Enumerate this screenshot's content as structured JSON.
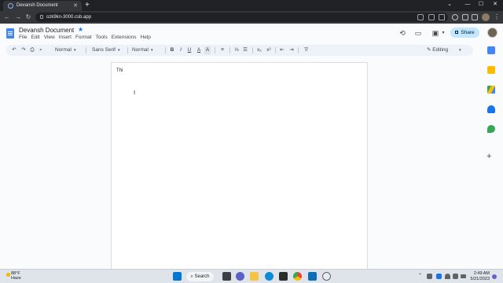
{
  "browser": {
    "tab_title": "Devansh Document",
    "tab_close": "✕",
    "new_tab": "+",
    "url": "ozk9kn-3000.csb.app",
    "window_controls": [
      "⌄",
      "—",
      "☐",
      "✕"
    ],
    "nav": {
      "back": "←",
      "forward": "→",
      "reload": "↻"
    },
    "menu_glyph": "⋮"
  },
  "docs": {
    "title": "Devansh Document",
    "star_glyph": "★",
    "menu": [
      "File",
      "Edit",
      "View",
      "Insert",
      "Format",
      "Tools",
      "Extensions",
      "Help"
    ],
    "share_label": "Share",
    "header_icons": {
      "history": "⟲",
      "comments": "▭",
      "meet": "▣"
    }
  },
  "toolbar": {
    "undo": "↶",
    "redo": "↷",
    "print": "⎙",
    "paint_format": "⌕",
    "zoom": "Normal",
    "font": "Sans Serif",
    "size": "Normal",
    "bold": "B",
    "italic": "I",
    "underline": "U",
    "text_color": "A",
    "highlight": "A",
    "align": "≡",
    "numbered_list": "⅓",
    "bullet_list": "☰",
    "subscript": "x₂",
    "superscript": "x²",
    "indent_less": "⇤",
    "indent_more": "⇥",
    "clear_format": "T̸",
    "editing": "Editing",
    "editing_pencil": "✎",
    "caret": "▾"
  },
  "page": {
    "text": "Thi",
    "cursor": "I"
  },
  "side_panel": {
    "plus": "+"
  },
  "taskbar": {
    "temperature": "88°F",
    "condition": "Haze",
    "search_label": "⌕ Search",
    "time": "2:49 AM",
    "date": "5/21/2023",
    "tray_caret": "⌃"
  },
  "colors": {
    "titlebar": "#202124",
    "addressbar": "#35363a",
    "docs_bg": "#f9fbfd",
    "toolbar_bg": "#edf2fa",
    "share_bg": "#c2e7ff",
    "docs_blue": "#4285f4",
    "taskbar": "#dfe3ea"
  }
}
